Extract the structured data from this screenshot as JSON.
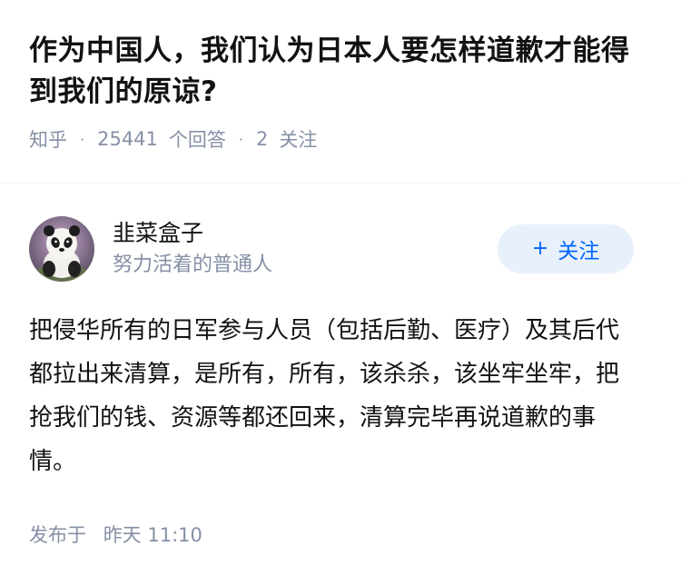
{
  "question": {
    "title": "作为中国人，我们认为日本人要怎样道歉才能得到我们的原谅?",
    "source": "知乎",
    "answer_count": "25441",
    "answer_count_label": "个回答",
    "follower_count": "2",
    "follower_count_label": "关注"
  },
  "answer": {
    "author": {
      "name": "韭菜盒子",
      "bio": "努力活着的普通人",
      "follow_label": "关注"
    },
    "content": "把侵华所有的日军参与人员（包括后勤、医疗）及其后代都拉出来清算，是所有，所有，该杀杀，该坐牢坐牢，把抢我们的钱、资源等都还回来，清算完毕再说道歉的事情。",
    "publish_label": "发布于",
    "publish_time": "昨天 11:10"
  },
  "colors": {
    "meta_text": "#8590a6",
    "follow_bg": "#e8f1fb",
    "follow_text": "#0066ff"
  },
  "icons": {
    "avatar": "panda-avatar",
    "follow": "plus-icon"
  }
}
